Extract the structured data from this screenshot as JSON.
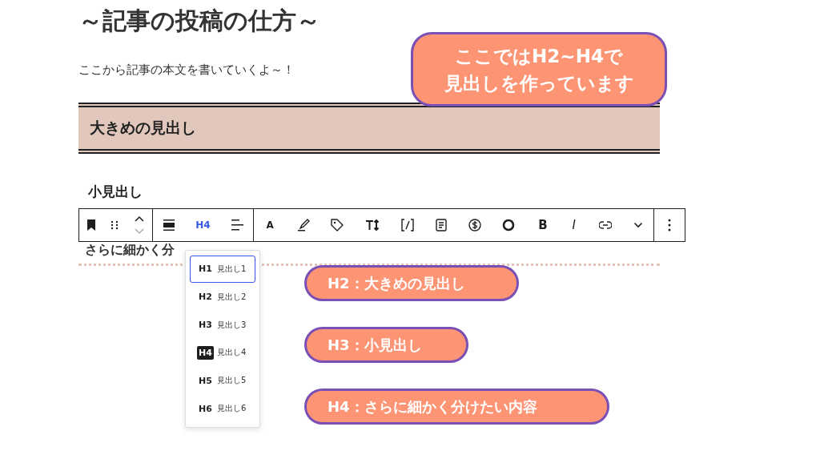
{
  "title": "～記事の投稿の仕方～",
  "intro": "ここから記事の本文を書いていくよ～！",
  "heading_h2": "大きめの見出し",
  "heading_h3": "小見出し",
  "heading_h4": "さらに細かく分",
  "toolbar": {
    "heading_button": "H4",
    "text_buttons": [
      "A",
      "B",
      "I"
    ]
  },
  "heading_menu": [
    {
      "level": "H1",
      "label": "見出し1",
      "focused": true,
      "selected": false
    },
    {
      "level": "H2",
      "label": "見出し2",
      "focused": false,
      "selected": false
    },
    {
      "level": "H3",
      "label": "見出し3",
      "focused": false,
      "selected": false
    },
    {
      "level": "H4",
      "label": "見出し4",
      "focused": false,
      "selected": true
    },
    {
      "level": "H5",
      "label": "見出し5",
      "focused": false,
      "selected": false
    },
    {
      "level": "H6",
      "label": "見出し6",
      "focused": false,
      "selected": false
    }
  ],
  "callouts": [
    {
      "kind": "big",
      "lines": [
        "ここではH2~H4で",
        "見出しを作っています"
      ]
    },
    {
      "kind": "small",
      "lines": [
        "H2：大きめの見出し"
      ]
    },
    {
      "kind": "small",
      "lines": [
        "H3：小見出し"
      ]
    },
    {
      "kind": "small",
      "lines": [
        "H4：さらに細かく分けたい内容"
      ]
    }
  ]
}
